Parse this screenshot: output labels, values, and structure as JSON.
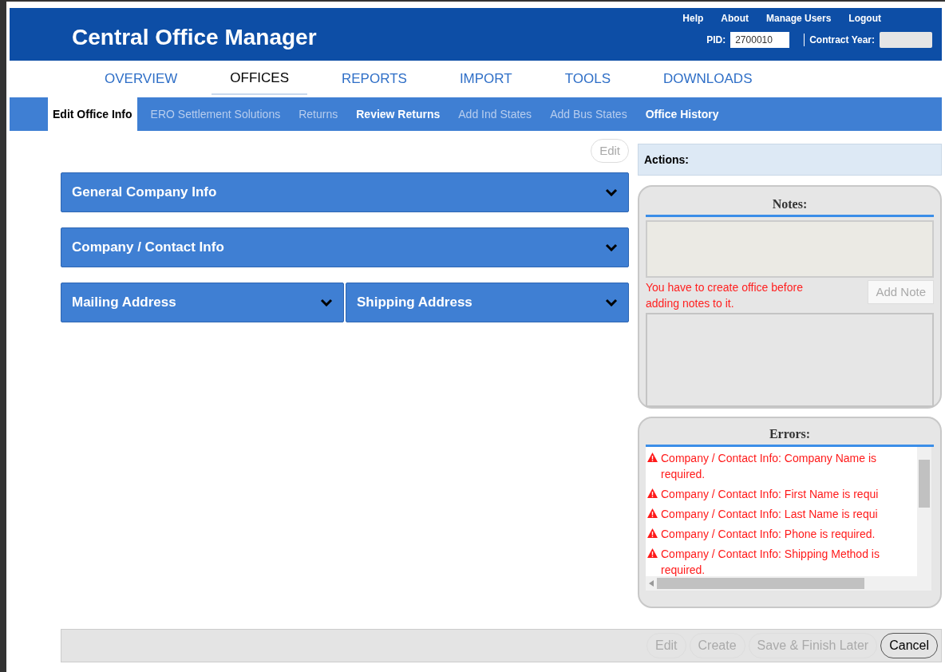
{
  "header": {
    "title": "Central Office Manager",
    "links": [
      "Help",
      "About",
      "Manage Users",
      "Logout"
    ],
    "pid_label": "PID:",
    "pid_value": "2700010",
    "contract_year_label": "Contract Year:"
  },
  "nav_tabs": [
    {
      "label": "OVERVIEW",
      "selected": false
    },
    {
      "label": "OFFICES",
      "selected": true
    },
    {
      "label": "REPORTS",
      "selected": false
    },
    {
      "label": "IMPORT",
      "selected": false
    },
    {
      "label": "TOOLS",
      "selected": false
    },
    {
      "label": "DOWNLOADS",
      "selected": false
    }
  ],
  "sub_tabs": [
    {
      "label": "Edit Office Info",
      "selected": true,
      "disabled": false
    },
    {
      "label": "ERO Settlement Solutions",
      "selected": false,
      "disabled": true
    },
    {
      "label": "Returns",
      "selected": false,
      "disabled": true
    },
    {
      "label": "Review Returns",
      "selected": false,
      "disabled": false
    },
    {
      "label": "Add Ind States",
      "selected": false,
      "disabled": true
    },
    {
      "label": "Add Bus States",
      "selected": false,
      "disabled": true
    },
    {
      "label": "Office History",
      "selected": false,
      "disabled": false
    }
  ],
  "edit_button": {
    "label": "Edit",
    "disabled": true
  },
  "sections": [
    [
      {
        "title": "General Company Info",
        "expanded": false
      }
    ],
    [
      {
        "title": "Company / Contact Info",
        "expanded": false
      }
    ],
    [
      {
        "title": "Mailing Address",
        "expanded": false
      },
      {
        "title": "Shipping Address",
        "expanded": false
      }
    ]
  ],
  "actions": {
    "title": "Actions:"
  },
  "notes": {
    "title": "Notes:",
    "message": "You have to create office before adding notes to it.",
    "add_button": {
      "label": "Add Note",
      "disabled": true
    }
  },
  "errors": {
    "title": "Errors:",
    "items": [
      "Company / Contact Info: Company Name is required.",
      "Company / Contact Info: First Name is requi",
      "Company / Contact Info: Last Name is requi",
      "Company / Contact Info: Phone is required.",
      "Company / Contact Info: Shipping Method is required."
    ]
  },
  "footer_buttons": [
    {
      "label": "Edit",
      "disabled": true
    },
    {
      "label": "Create",
      "disabled": true
    },
    {
      "label": "Save & Finish Later",
      "disabled": true
    },
    {
      "label": "Cancel",
      "disabled": false
    }
  ]
}
